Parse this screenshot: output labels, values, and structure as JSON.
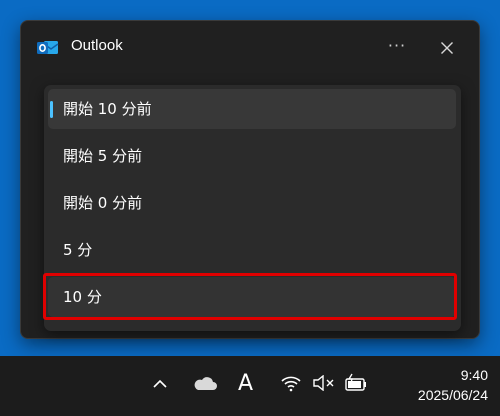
{
  "window": {
    "app_title": "Outlook",
    "app_icon": "outlook-icon",
    "more_icon": "more-options-icon",
    "close_icon": "close-icon"
  },
  "dropdown": {
    "options": [
      {
        "label": "開始 10 分前",
        "selected": true
      },
      {
        "label": "開始 5 分前",
        "selected": false
      },
      {
        "label": "開始 0 分前",
        "selected": false
      },
      {
        "label": "5 分",
        "selected": false
      },
      {
        "label": "10 分",
        "selected": false,
        "highlighted": true
      }
    ]
  },
  "taskbar": {
    "tray_icons": [
      "chevron-up-icon",
      "onedrive-cloud-icon",
      "ime-a-icon",
      "wifi-icon",
      "volume-muted-icon",
      "battery-charging-icon"
    ],
    "ime_label": "A",
    "time": "9:40",
    "date": "2025/06/24"
  },
  "colors": {
    "desktop": "#0a6bc4",
    "accent": "#4cc2ff",
    "annotation": "#e00000"
  }
}
